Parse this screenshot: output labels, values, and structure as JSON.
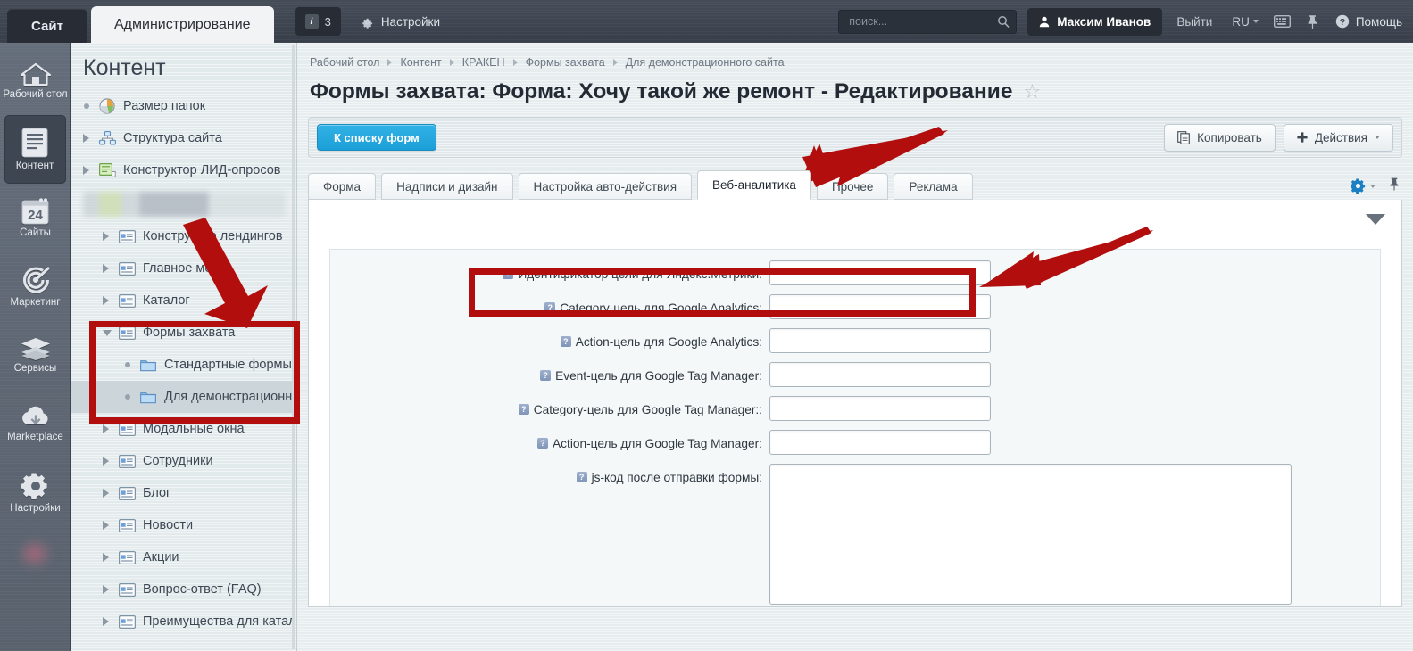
{
  "topbar": {
    "site_tab": "Сайт",
    "admin_tab": "Администрирование",
    "info_count": "3",
    "info_icon": "info-icon",
    "settings_label": "Настройки",
    "settings_icon": "gear-icon",
    "search_placeholder": "поиск...",
    "search_value": "",
    "search_icon": "search-icon",
    "user_name": "Максим Иванов",
    "user_icon": "user-icon",
    "logout_label": "Выйти",
    "lang_label": "RU",
    "keyboard_icon": "keyboard-icon",
    "pin_icon": "pin-icon",
    "help_label": "Помощь",
    "help_icon": "question-circle-icon"
  },
  "rail": {
    "items": [
      {
        "label": "Рабочий стол",
        "icon": "home-icon",
        "active": false
      },
      {
        "label": "Контент",
        "icon": "document-icon",
        "active": true
      },
      {
        "label": "Сайты",
        "icon": "calendar-24-icon",
        "active": false
      },
      {
        "label": "Маркетинг",
        "icon": "target-icon",
        "active": false
      },
      {
        "label": "Сервисы",
        "icon": "layers-icon",
        "active": false
      },
      {
        "label": "Marketplace",
        "icon": "cloud-download-icon",
        "active": false
      },
      {
        "label": "Настройки",
        "icon": "gear-icon",
        "active": false
      }
    ]
  },
  "tree": {
    "title": "Контент",
    "items": [
      {
        "label": "Размер папок",
        "level": 1,
        "twisty": "dot",
        "icon": "pie-chart-icon",
        "selected": false
      },
      {
        "label": "Структура сайта",
        "level": 1,
        "twisty": "right",
        "icon": "sitemap-icon",
        "selected": false
      },
      {
        "label": "Конструктор ЛИД-опросов",
        "level": 1,
        "twisty": "right",
        "icon": "green-doc-icon",
        "selected": false
      },
      {
        "label": "",
        "level": 1,
        "twisty": "blurred",
        "icon": "blurred-icon",
        "selected": false
      },
      {
        "label": "Конструктор лендингов",
        "level": 2,
        "twisty": "right",
        "icon": "section-icon",
        "selected": false
      },
      {
        "label": "Главное меню",
        "level": 2,
        "twisty": "right",
        "icon": "section-icon",
        "selected": false
      },
      {
        "label": "Каталог",
        "level": 2,
        "twisty": "right",
        "icon": "section-icon",
        "selected": false
      },
      {
        "label": "Формы захвата",
        "level": 2,
        "twisty": "down",
        "icon": "section-icon",
        "selected": false
      },
      {
        "label": "Стандартные формы",
        "level": 3,
        "twisty": "dot",
        "icon": "folder-icon",
        "selected": false
      },
      {
        "label": "Для демонстрационног",
        "level": 3,
        "twisty": "dot",
        "icon": "folder-icon",
        "selected": true
      },
      {
        "label": "Модальные окна",
        "level": 2,
        "twisty": "right",
        "icon": "section-icon",
        "selected": false
      },
      {
        "label": "Сотрудники",
        "level": 2,
        "twisty": "right",
        "icon": "section-icon",
        "selected": false
      },
      {
        "label": "Блог",
        "level": 2,
        "twisty": "right",
        "icon": "section-icon",
        "selected": false
      },
      {
        "label": "Новости",
        "level": 2,
        "twisty": "right",
        "icon": "section-icon",
        "selected": false
      },
      {
        "label": "Акции",
        "level": 2,
        "twisty": "right",
        "icon": "section-icon",
        "selected": false
      },
      {
        "label": "Вопрос-ответ (FAQ)",
        "level": 2,
        "twisty": "right",
        "icon": "section-icon",
        "selected": false
      },
      {
        "label": "Преимущества для катало",
        "level": 2,
        "twisty": "right",
        "icon": "section-icon",
        "selected": false
      }
    ]
  },
  "breadcrumb": [
    "Рабочий стол",
    "Контент",
    "КРАКЕН",
    "Формы захвата",
    "Для демонстрационного сайта"
  ],
  "page": {
    "title": "Формы захвата: Форма: Хочу такой же ремонт - Редактирование",
    "star_icon": "star-icon"
  },
  "toolbar": {
    "back_label": "К списку форм",
    "copy_label": "Копировать",
    "copy_icon": "copy-icon",
    "actions_label": "Действия",
    "actions_icon": "plus-icon"
  },
  "tabs": {
    "items": [
      {
        "label": "Форма",
        "active": false
      },
      {
        "label": "Надписи и дизайн",
        "active": false
      },
      {
        "label": "Настройка авто-действия",
        "active": false
      },
      {
        "label": "Веб-аналитика",
        "active": true
      },
      {
        "label": "Прочее",
        "active": false
      },
      {
        "label": "Реклама",
        "active": false
      }
    ],
    "settings_icon": "gear-blue-icon",
    "pin_icon": "pin-icon"
  },
  "form": {
    "collapse_icon": "chevron-down-icon",
    "fields": [
      {
        "label": "Идентификатор цели для Яндекс.Метрики:",
        "value": "",
        "type": "text",
        "name": "yandex-metrika-goal-id"
      },
      {
        "label": "Category-цель для Google Analytics:",
        "value": "",
        "type": "text",
        "name": "ga-category-goal"
      },
      {
        "label": "Action-цель для Google Analytics:",
        "value": "",
        "type": "text",
        "name": "ga-action-goal"
      },
      {
        "label": "Event-цель для Google Tag Manager:",
        "value": "",
        "type": "text",
        "name": "gtm-event-goal"
      },
      {
        "label": "Category-цель для Google Tag Manager::",
        "value": "",
        "type": "text",
        "name": "gtm-category-goal"
      },
      {
        "label": "Action-цель для Google Tag Manager:",
        "value": "",
        "type": "text",
        "name": "gtm-action-goal"
      },
      {
        "label": "js-код после отправки формы:",
        "value": "",
        "type": "textarea",
        "name": "js-code-after-submit"
      }
    ]
  },
  "annotations": {
    "color": "#b30e0e",
    "items": [
      "tree-highlight-box",
      "arrow-to-tree",
      "tabs-arrow-to-web-analytics",
      "field-highlight-box",
      "arrow-to-field"
    ]
  }
}
